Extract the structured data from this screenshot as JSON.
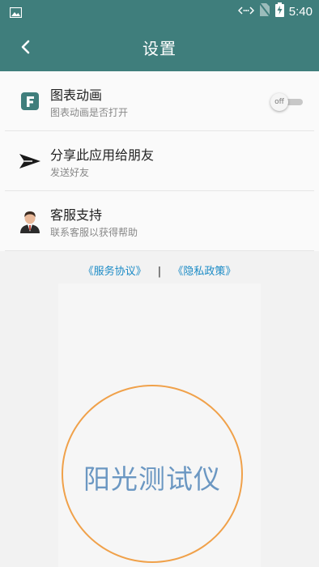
{
  "status_bar": {
    "time": "5:40"
  },
  "app_bar": {
    "title": "设置"
  },
  "settings": [
    {
      "title": "图表动画",
      "subtitle": "图表动画是否打开",
      "icon": "letter-f-icon",
      "toggle_label": "off"
    },
    {
      "title": "分享此应用给朋友",
      "subtitle": "发送好友",
      "icon": "send-icon"
    },
    {
      "title": "客服支持",
      "subtitle": "联系客服以获得帮助",
      "icon": "customer-service-icon"
    }
  ],
  "links": {
    "service": "《服务协议》",
    "separator": "|",
    "privacy": "《隐私政策》"
  },
  "brand": {
    "name": "阳光测试仪"
  },
  "colors": {
    "primary": "#3f7e7c",
    "link": "#1b8bc6",
    "brand_text": "#6b97c2",
    "ring": "#f0a14a"
  }
}
